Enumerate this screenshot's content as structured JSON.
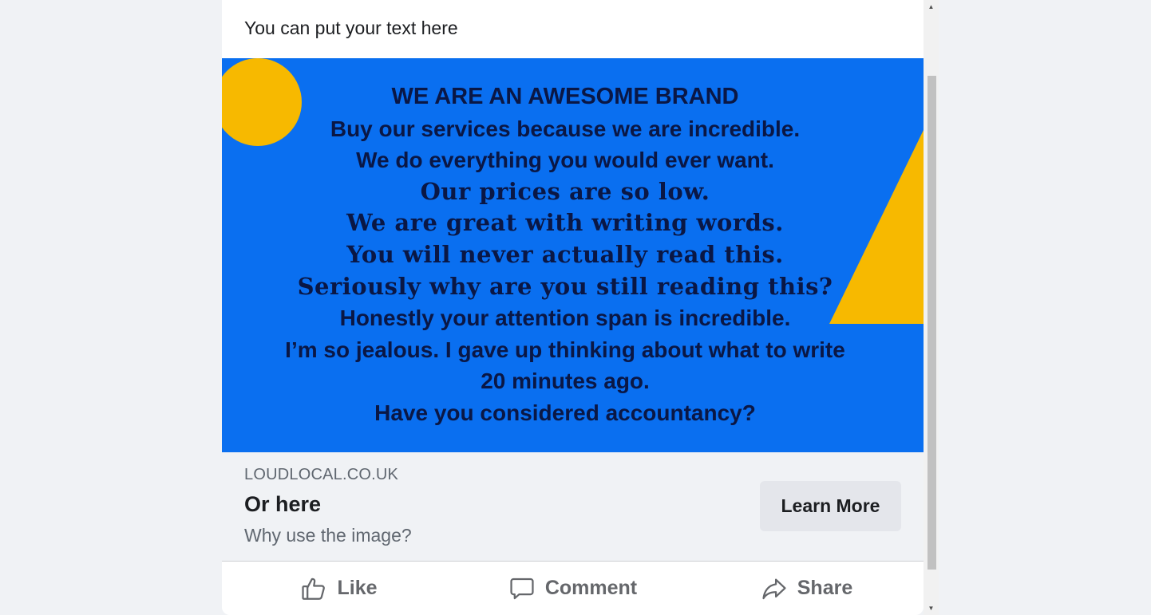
{
  "post": {
    "text": "You can put your text here"
  },
  "ad_image": {
    "lines": [
      "WE ARE AN AWESOME BRAND",
      "Buy our services because we are incredible.",
      "We do everything you would ever want.",
      "Our prices are so low.",
      "We are great with writing words.",
      "You will never actually read this.",
      "Seriously why are you still reading this?",
      "Honestly your attention span is incredible.",
      "I’m so jealous. I gave up thinking about what to write",
      "20 minutes ago.",
      "Have you considered accountancy?"
    ],
    "colors": {
      "background": "#0a6ff0",
      "shapes": "#f7b900",
      "text": "#0a1745"
    }
  },
  "link": {
    "domain": "LOUDLOCAL.CO.UK",
    "headline": "Or here",
    "description": "Why use the image?",
    "cta_label": "Learn More"
  },
  "actions": {
    "like": {
      "label": "Like",
      "icon": "thumbs-up-icon"
    },
    "comment": {
      "label": "Comment",
      "icon": "comment-bubble-icon"
    },
    "share": {
      "label": "Share",
      "icon": "share-arrow-icon"
    }
  },
  "scrollbar": {
    "up_icon": "scroll-up-arrow-icon",
    "down_icon": "scroll-down-arrow-icon"
  }
}
